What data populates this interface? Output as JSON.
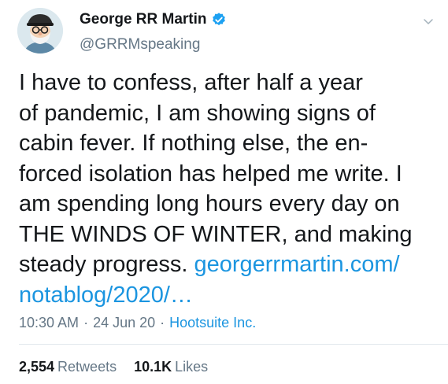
{
  "author": {
    "display_name": "George RR Martin",
    "handle": "@GRRMspeaking",
    "verified": true
  },
  "tweet": {
    "text_plain": "I have to confess, after half a year\nof pandemic, I am showing signs of\ncabin fever. If nothing else, the en-\nforced isolation has helped me write. I\nam spending long hours every day on\nTHE WINDS OF WINTER, and making\nsteady progress. ",
    "link_text": "georgerrmartin.com/\nnotablog/2020/…"
  },
  "meta": {
    "time": "10:30 AM",
    "separator": "·",
    "date": "24 Jun 20",
    "source": "Hootsuite Inc."
  },
  "stats": {
    "retweets_count": "2,554",
    "retweets_label": "Retweets",
    "likes_count": "10.1K",
    "likes_label": "Likes"
  },
  "colors": {
    "accent": "#1b95e0",
    "secondary_text": "#657786",
    "primary_text": "#14171a"
  },
  "icons": {
    "verified": "verified-badge-icon",
    "more": "chevron-down-icon"
  }
}
